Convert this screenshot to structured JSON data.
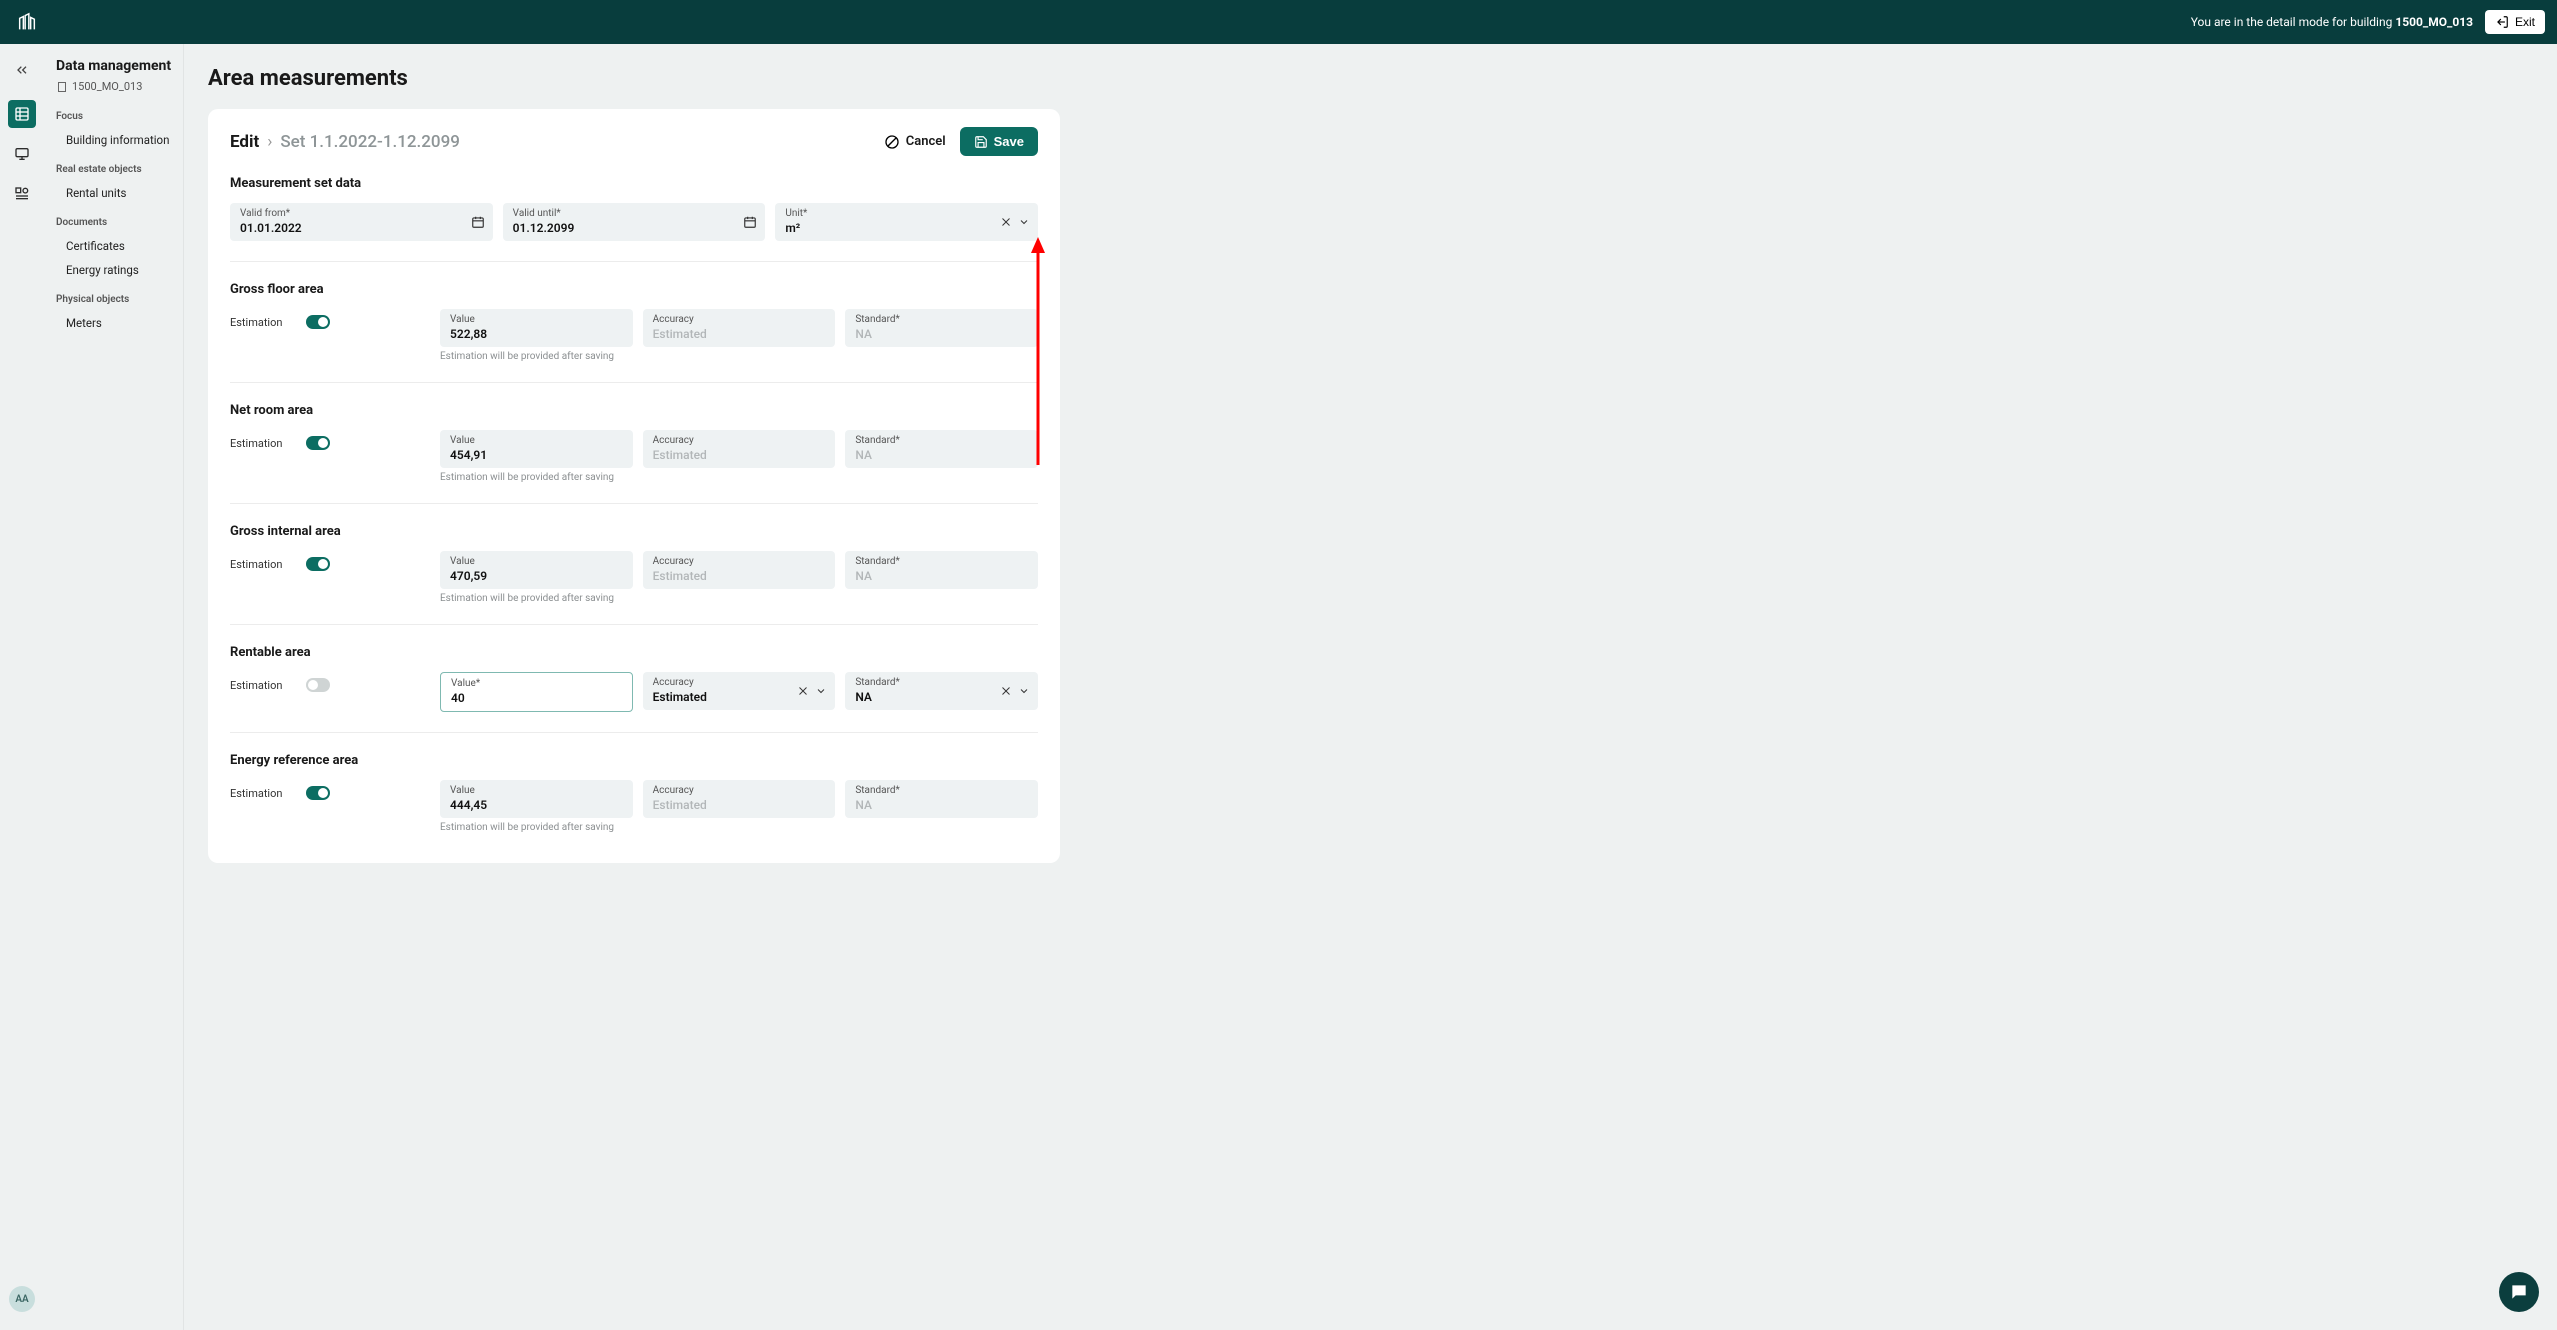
{
  "header": {
    "detail_mode_prefix": "You are in the detail mode for building ",
    "building_id": "1500_MO_013",
    "exit_label": "Exit"
  },
  "rail": {
    "avatar": "AA"
  },
  "sidebar": {
    "title": "Data management",
    "building": "1500_MO_013",
    "groups": [
      {
        "label": "Focus",
        "items": [
          "Building information"
        ]
      },
      {
        "label": "Real estate objects",
        "items": [
          "Rental units"
        ]
      },
      {
        "label": "Documents",
        "items": [
          "Certificates",
          "Energy ratings"
        ]
      },
      {
        "label": "Physical objects",
        "items": [
          "Meters"
        ]
      }
    ]
  },
  "page": {
    "title": "Area measurements",
    "edit_label": "Edit",
    "set_label": "Set 1.1.2022-1.12.2099",
    "cancel_label": "Cancel",
    "save_label": "Save"
  },
  "set_data": {
    "section_title": "Measurement set data",
    "valid_from_label": "Valid from*",
    "valid_from_value": "01.01.2022",
    "valid_until_label": "Valid until*",
    "valid_until_value": "01.12.2099",
    "unit_label": "Unit*",
    "unit_value": "m²"
  },
  "common": {
    "estimation_label": "Estimation",
    "value_label": "Value",
    "value_req_label": "Value*",
    "accuracy_label": "Accuracy",
    "standard_label": "Standard*",
    "estimated_text": "Estimated",
    "na_text": "NA",
    "hint": "Estimation will be provided after saving"
  },
  "areas": [
    {
      "title": "Gross floor area",
      "estimation": true,
      "value": "522,88",
      "accuracy": "Estimated",
      "standard": "NA",
      "editable": false
    },
    {
      "title": "Net room area",
      "estimation": true,
      "value": "454,91",
      "accuracy": "Estimated",
      "standard": "NA",
      "editable": false
    },
    {
      "title": "Gross internal area",
      "estimation": true,
      "value": "470,59",
      "accuracy": "Estimated",
      "standard": "NA",
      "editable": false
    },
    {
      "title": "Rentable area",
      "estimation": false,
      "value": "40",
      "accuracy": "Estimated",
      "standard": "NA",
      "editable": true
    },
    {
      "title": "Energy reference area",
      "estimation": true,
      "value": "444,45",
      "accuracy": "Estimated",
      "standard": "NA",
      "editable": false
    }
  ]
}
